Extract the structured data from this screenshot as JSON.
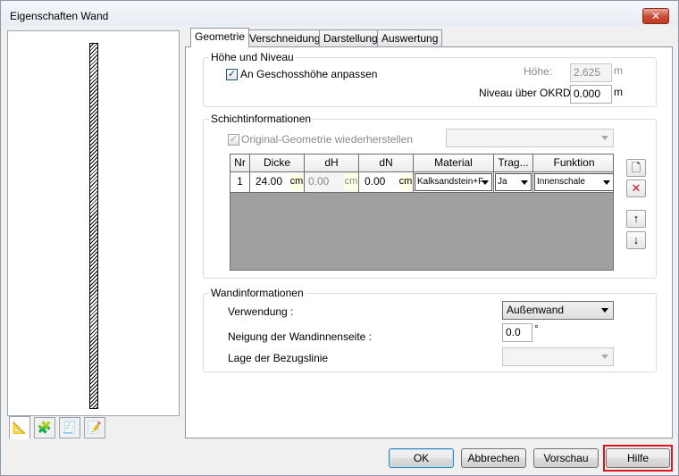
{
  "window": {
    "title": "Eigenschaften Wand",
    "close_symbol": "✕"
  },
  "preview_tabs": [
    {
      "icon": "ruler-icon",
      "glyph": "📐"
    },
    {
      "icon": "objects-icon",
      "glyph": "🧩"
    },
    {
      "icon": "properties-icon",
      "glyph": "🧾"
    },
    {
      "icon": "notes-icon",
      "glyph": "📝"
    }
  ],
  "tabs": [
    "Geometrie",
    "Verschneidung",
    "Darstellung",
    "Auswertung"
  ],
  "hoehe_niveau": {
    "title": "Höhe und Niveau",
    "checkbox_label": "An Geschosshöhe anpassen",
    "checkbox_checked": true,
    "hoehe_label": "Höhe:",
    "hoehe_value": "2.625",
    "hoehe_unit": "m",
    "niveau_label": "Niveau über OKRD:",
    "niveau_value": "0.000",
    "niveau_unit": "m"
  },
  "schicht": {
    "title": "Schichtinformationen",
    "checkbox_label": "Original-Geometrie wiederherstellen",
    "checkbox_checked": true,
    "combo_value": "",
    "headers": [
      "Nr",
      "Dicke",
      "dH",
      "dN",
      "Material",
      "Trag...",
      "Funktion"
    ],
    "row": {
      "nr": "1",
      "dicke": "24.00",
      "dicke_unit": "cm",
      "dh": "0.00",
      "dh_unit": "cm",
      "dn": "0.00",
      "dn_unit": "cm",
      "material": "Kalksandstein+F",
      "trag": "Ja",
      "funktion": "Innenschale"
    }
  },
  "wand": {
    "title": "Wandinformationen",
    "verwendung_label": "Verwendung :",
    "verwendung_value": "Außenwand",
    "neigung_label": "Neigung der Wandinnenseite :",
    "neigung_value": "0.0",
    "neigung_unit": "°",
    "lage_label": "Lage der Bezugslinie",
    "lage_value": ""
  },
  "buttons": {
    "ok": "OK",
    "cancel": "Abbrechen",
    "preview": "Vorschau",
    "help": "Hilfe"
  }
}
